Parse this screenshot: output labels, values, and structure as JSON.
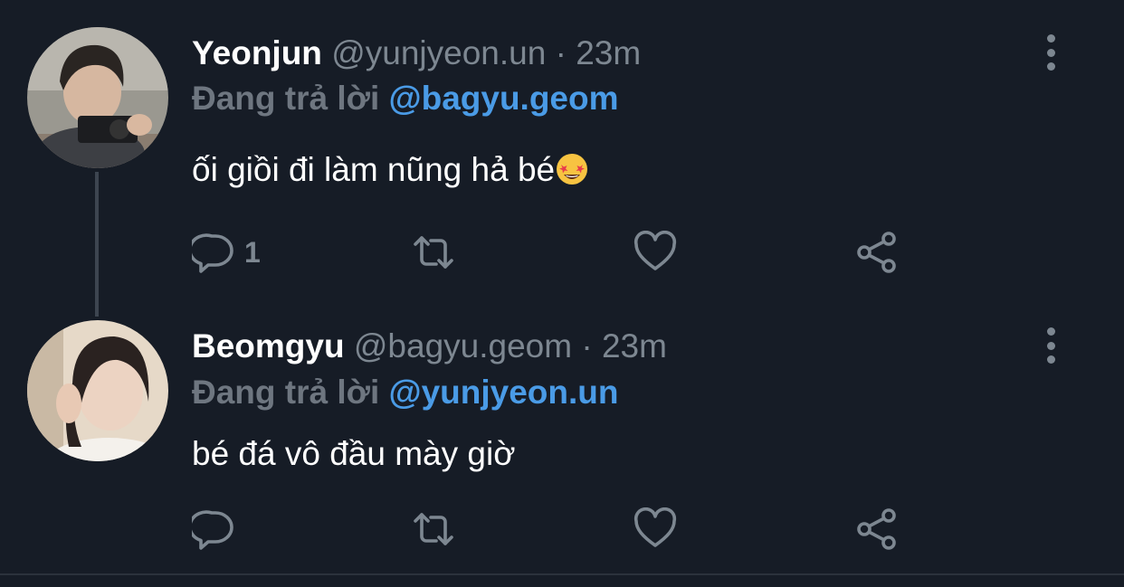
{
  "tweets": [
    {
      "display_name": "Yeonjun",
      "handle": "@yunjyeon.un",
      "separator": "·",
      "time": "23m",
      "replying_prefix": "Đang trả lời",
      "replying_handle": "@bagyu.geom",
      "text": "ối giồi đi làm nũng hả bé",
      "emoji": "star-struck-emoji",
      "reply_count": "1"
    },
    {
      "display_name": "Beomgyu",
      "handle": "@bagyu.geom",
      "separator": "·",
      "time": "23m",
      "replying_prefix": "Đang trả lời",
      "replying_handle": "@yunjyeon.un",
      "text": "bé đá vô đầu mày giờ",
      "reply_count": ""
    }
  ],
  "colors": {
    "background": "#161c26",
    "muted": "#7d8791",
    "link": "#4a9be6",
    "thread_line": "#3d4550"
  },
  "icons": [
    "more-vertical-icon",
    "reply-icon",
    "retweet-icon",
    "like-icon",
    "share-icon"
  ]
}
